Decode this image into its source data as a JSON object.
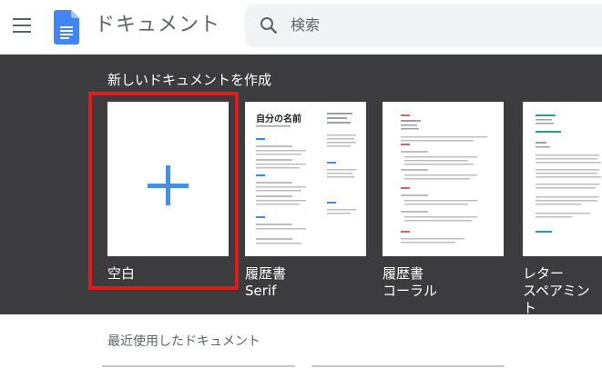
{
  "header": {
    "app_title": "ドキュメント",
    "search_placeholder": "検索",
    "menu_icon": "hamburger-menu-icon",
    "logo_icon": "docs-logo-icon",
    "search_icon": "search-icon"
  },
  "templates": {
    "section_title": "新しいドキュメントを作成",
    "items": [
      {
        "line1": "空白",
        "line2": "",
        "icon": "plus-icon",
        "selected": true
      },
      {
        "line1": "履歴書",
        "line2": "Serif",
        "heading": "自分の名前"
      },
      {
        "line1": "履歴書",
        "line2": "コーラル"
      },
      {
        "line1": "レター",
        "line2": "スペアミント"
      }
    ]
  },
  "recent": {
    "section_title": "最近使用したドキュメント"
  },
  "colors": {
    "template_bg": "#3c3c3e",
    "highlight": "#e01b1b",
    "plus": "#4a90d9",
    "coral": "#e06055",
    "spearmint": "#2a9d8f"
  }
}
